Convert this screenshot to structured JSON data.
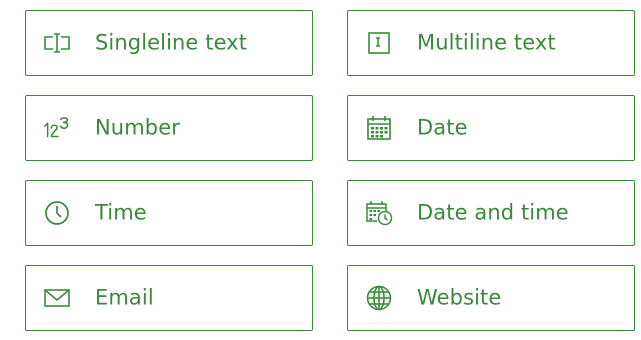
{
  "accent_color": "#3b8a3b",
  "field_types": [
    {
      "label": "Singleline text",
      "icon": "singleline-text-icon"
    },
    {
      "label": "Multiline text",
      "icon": "multiline-text-icon"
    },
    {
      "label": "Number",
      "icon": "number-icon"
    },
    {
      "label": "Date",
      "icon": "calendar-icon"
    },
    {
      "label": "Time",
      "icon": "clock-icon"
    },
    {
      "label": "Date and time",
      "icon": "calendar-clock-icon"
    },
    {
      "label": "Email",
      "icon": "envelope-icon"
    },
    {
      "label": "Website",
      "icon": "globe-icon"
    }
  ]
}
